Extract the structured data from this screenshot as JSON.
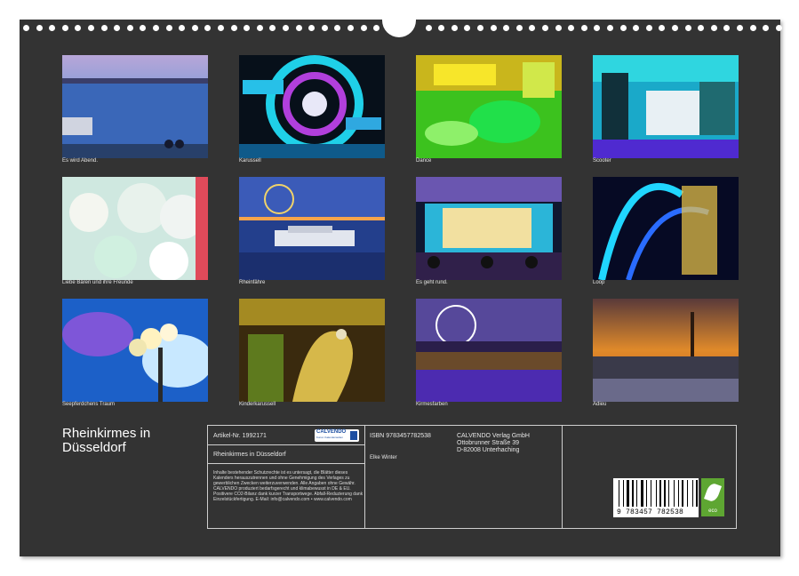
{
  "calendar": {
    "title": "Rheinkirmes in Düsseldorf",
    "title_line1": "Rheinkirmes in",
    "title_line2": "Düsseldorf"
  },
  "photos": [
    {
      "caption": "Es wird Abend.",
      "icon": "riverfront-dusk-photo"
    },
    {
      "caption": "Karussell",
      "icon": "predator-ride-photo"
    },
    {
      "caption": "Dance",
      "icon": "dance-ride-photo"
    },
    {
      "caption": "Scooter",
      "icon": "bumper-cars-photo"
    },
    {
      "caption": "Liebe Bären und ihre Freunde",
      "icon": "plush-bears-photo"
    },
    {
      "caption": "Rheinfähre",
      "icon": "rhine-ferry-photo"
    },
    {
      "caption": "Es geht rund.",
      "icon": "carousel-lights-photo"
    },
    {
      "caption": "Loop",
      "icon": "loop-coaster-photo"
    },
    {
      "caption": "Seepferdchens Traum",
      "icon": "street-lamp-photo"
    },
    {
      "caption": "Kinderkarussell",
      "icon": "seahorse-carousel-photo"
    },
    {
      "caption": "Kirmesfarben",
      "icon": "ferris-wheel-night-photo"
    },
    {
      "caption": "Adieu",
      "icon": "sunset-fair-photo"
    }
  ],
  "info": {
    "article": "Artikel-Nr. 1992171",
    "brand": "CALVENDO",
    "brand_sub": "Kunst. Kalenderwelten",
    "name": "Rheinkirmes in Düsseldorf",
    "isbn": "ISBN 9783457782538",
    "author": "Elke Winter",
    "publisher_line1": "CALVENDO Verlag GmbH",
    "publisher_line2": "Ottobrunner Straße 39",
    "publisher_line3": "D-82008 Unterhaching",
    "legal": "Inhalte bestehender Schutzrechte ist es untersagt, die Blätter dieses Kalenders herauszutrennen und ohne Genehmigung des Verlages zu gewerblichen Zwecken weiterzuverwenden. Alle Angaben ohne Gewähr. CALVENDO produziert bedarfsgerecht und klimabewusst in DE & EU. Positivere CO2-Bilanz dank kurzer Transportwege. Abfall-Reduzierung dank Einzelstückfertigung. E-Mail: info@calvendo.com • www.calvendo.com",
    "barcode": "9 783457 782538",
    "eco_label": "eco"
  }
}
